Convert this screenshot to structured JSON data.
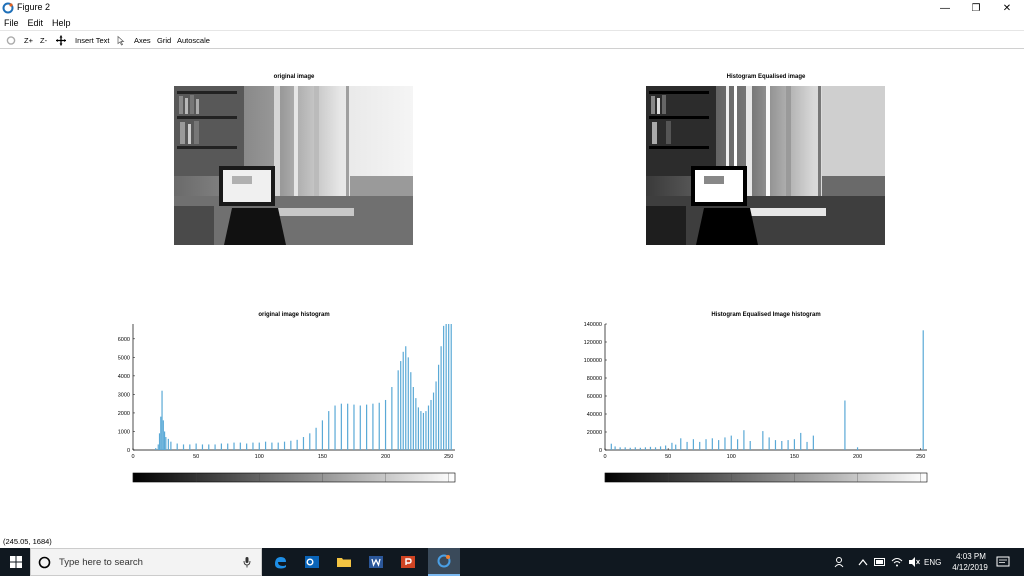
{
  "window": {
    "title": "Figure 2",
    "minimize": "—",
    "maximize": "❐",
    "close": "✕"
  },
  "menu": {
    "file": "File",
    "edit": "Edit",
    "help": "Help"
  },
  "toolbar": {
    "zoom_in": "Z+",
    "zoom_out": "Z-",
    "insert_text": "Insert Text",
    "axes": "Axes",
    "grid": "Grid",
    "autoscale": "Autoscale"
  },
  "plots": {
    "orig_image_title": "original image",
    "eq_image_title": "Histogram Equalised image",
    "orig_hist_title": "original image histogram",
    "eq_hist_title": "Histogram Equalised Image histogram"
  },
  "chart_data": [
    {
      "type": "bar",
      "title": "original image histogram",
      "xlim": [
        0,
        255
      ],
      "ylim": [
        0,
        6800
      ],
      "xticks": [
        "0",
        "50",
        "100",
        "150",
        "200",
        "250"
      ],
      "yticks": [
        "0",
        "1000",
        "2000",
        "3000",
        "4000",
        "5000",
        "6000"
      ],
      "color": "#5aa9d6",
      "x": [
        18,
        20,
        21,
        22,
        23,
        24,
        25,
        26,
        28,
        30,
        35,
        40,
        45,
        50,
        55,
        60,
        65,
        70,
        75,
        80,
        85,
        90,
        95,
        100,
        105,
        110,
        115,
        120,
        125,
        130,
        135,
        140,
        145,
        150,
        155,
        160,
        165,
        170,
        175,
        180,
        185,
        190,
        195,
        200,
        205,
        210,
        212,
        214,
        216,
        218,
        220,
        222,
        224,
        226,
        228,
        230,
        232,
        234,
        236,
        238,
        240,
        242,
        244,
        246,
        248,
        250,
        252
      ],
      "values": [
        100,
        300,
        900,
        1800,
        3200,
        1600,
        1000,
        700,
        600,
        450,
        350,
        300,
        300,
        350,
        300,
        300,
        300,
        350,
        350,
        400,
        400,
        350,
        400,
        400,
        450,
        400,
        400,
        450,
        500,
        550,
        700,
        900,
        1200,
        1600,
        2100,
        2400,
        2500,
        2500,
        2450,
        2400,
        2450,
        2500,
        2550,
        2700,
        3400,
        4300,
        4800,
        5300,
        5600,
        5000,
        4200,
        3400,
        2800,
        2300,
        2100,
        2000,
        2100,
        2400,
        2700,
        3100,
        3700,
        4600,
        5600,
        6700,
        6800,
        6800,
        6800
      ]
    },
    {
      "type": "bar",
      "title": "Histogram Equalised Image histogram",
      "xlim": [
        0,
        255
      ],
      "ylim": [
        0,
        140000
      ],
      "xticks": [
        "0",
        "50",
        "100",
        "150",
        "200",
        "250"
      ],
      "yticks": [
        "0",
        "20000",
        "40000",
        "60000",
        "80000",
        "100000",
        "120000",
        "140000"
      ],
      "color": "#5aa9d6",
      "x": [
        5,
        8,
        12,
        16,
        20,
        24,
        28,
        32,
        36,
        40,
        44,
        48,
        53,
        56,
        60,
        65,
        70,
        75,
        80,
        85,
        90,
        95,
        100,
        105,
        110,
        115,
        125,
        130,
        135,
        140,
        145,
        150,
        155,
        160,
        165,
        190,
        200,
        252
      ],
      "values": [
        7000,
        4000,
        3000,
        3000,
        2500,
        3000,
        2500,
        3000,
        3500,
        3000,
        4000,
        5000,
        8000,
        6000,
        13000,
        9000,
        12000,
        9000,
        12000,
        13000,
        11000,
        14000,
        16000,
        12000,
        22000,
        10000,
        21000,
        14000,
        11000,
        10000,
        11000,
        12000,
        19000,
        9000,
        16000,
        55000,
        3000,
        133000
      ]
    }
  ],
  "colorbar": {
    "ticks": [
      "0",
      "50",
      "100",
      "150",
      "200",
      "250"
    ]
  },
  "status": {
    "coords": "(245.05, 1684)"
  },
  "taskbar": {
    "search_placeholder": "Type here to search",
    "lang": "ENG",
    "time": "4:03 PM",
    "date": "4/12/2019"
  }
}
